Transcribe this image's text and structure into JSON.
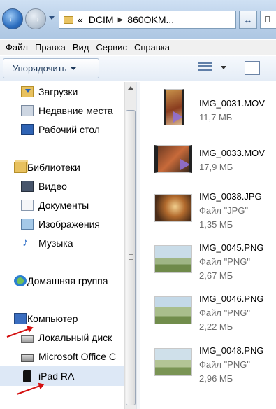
{
  "address": {
    "overflow_glyph": "«",
    "crumbs": [
      "DCIM",
      "860OKM..."
    ],
    "refresh_glyph": "↔",
    "search_placeholder": "П"
  },
  "menu": [
    "Файл",
    "Правка",
    "Вид",
    "Сервис",
    "Справка"
  ],
  "toolbar": {
    "organize_label": "Упорядочить"
  },
  "nav": {
    "favorites": [
      {
        "label": "Загрузки",
        "icon": "downloads-folder-icon"
      },
      {
        "label": "Недавние места",
        "icon": "recent-places-icon"
      },
      {
        "label": "Рабочий стол",
        "icon": "desktop-icon"
      }
    ],
    "libraries_label": "Библиотеки",
    "libraries": [
      {
        "label": "Видео",
        "icon": "video-library-icon"
      },
      {
        "label": "Документы",
        "icon": "documents-library-icon"
      },
      {
        "label": "Изображения",
        "icon": "images-library-icon"
      },
      {
        "label": "Музыка",
        "icon": "music-library-icon"
      }
    ],
    "homegroup_label": "Домашняя группа",
    "computer_label": "Компьютер",
    "computer": [
      {
        "label": "Локальный диск",
        "icon": "local-disk-icon"
      },
      {
        "label": "Microsoft Office C",
        "icon": "office-drive-icon"
      },
      {
        "label": "iPad RA",
        "icon": "ipad-device-icon"
      }
    ]
  },
  "files": [
    {
      "name": "IMG_0031.MOV",
      "type": "",
      "size": "11,7 МБ",
      "kind": "portrait-video"
    },
    {
      "name": "IMG_0033.MOV",
      "type": "",
      "size": "17,9 МБ",
      "kind": "video"
    },
    {
      "name": "IMG_0038.JPG",
      "type": "Файл \"JPG\"",
      "size": "1,35 МБ",
      "kind": "photo"
    },
    {
      "name": "IMG_0045.PNG",
      "type": "Файл \"PNG\"",
      "size": "2,67 МБ",
      "kind": "screenshot"
    },
    {
      "name": "IMG_0046.PNG",
      "type": "Файл \"PNG\"",
      "size": "2,22 МБ",
      "kind": "screenshot"
    },
    {
      "name": "IMG_0048.PNG",
      "type": "Файл \"PNG\"",
      "size": "2,96 МБ",
      "kind": "screenshot"
    }
  ],
  "colors": {
    "annotation_arrow": "#d41010",
    "selection": "#dde8f6",
    "folder": "#e8c15e"
  }
}
